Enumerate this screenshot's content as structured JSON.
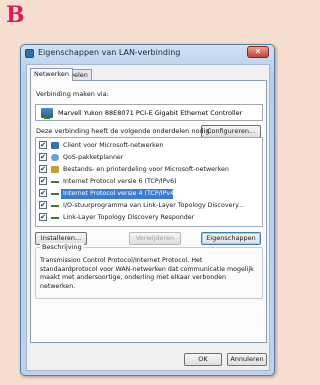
{
  "figure_letter": "B",
  "window": {
    "title": "Eigenschappen van LAN-verbinding",
    "close_symbol": "✕"
  },
  "tabs": [
    {
      "label": "Netwerken",
      "active": true
    },
    {
      "label": "Delen",
      "active": false
    }
  ],
  "connection": {
    "label": "Verbinding maken via:",
    "adapter": "Marvell Yukon 88E8071 PCI-E Gigabit Ethernet Controller",
    "configure_button": "Configureren..."
  },
  "items_label": "Deze verbinding heeft de volgende onderdelen nodig:",
  "items": [
    {
      "label": "Client voor Microsoft-netwerken",
      "checked": true,
      "icon": "client-icon",
      "selected": false
    },
    {
      "label": "QoS-pakketplanner",
      "checked": true,
      "icon": "qos-icon",
      "selected": false
    },
    {
      "label": "Bestands- en printerdeling voor Microsoft-netwerken",
      "checked": true,
      "icon": "share-icon",
      "selected": false
    },
    {
      "label": "Internet Protocol versie 6 (TCP/IPv6)",
      "checked": true,
      "icon": "protocol-icon",
      "selected": false
    },
    {
      "label": "Internet Protocol versie 4 (TCP/IPv4)",
      "checked": true,
      "icon": "protocol-icon",
      "selected": true
    },
    {
      "label": "I/O-stuurprogramma van Link-Layer Topology Discovery...",
      "checked": true,
      "icon": "protocol-icon",
      "selected": false
    },
    {
      "label": "Link-Layer Topology Discovery Responder",
      "checked": true,
      "icon": "protocol-icon",
      "selected": false
    }
  ],
  "buttons": {
    "install": "Installeren...",
    "remove": "Verwijderen",
    "properties": "Eigenschappen",
    "ok": "OK",
    "cancel": "Annuleren"
  },
  "description": {
    "title": "Beschrijving",
    "text": "Transmission Control Protocol/Internet Protocol. Het standaardprotocol voor WAN-netwerken dat communicatie mogelijk maakt met andersoortige, onderling met elkaar verbonden netwerken."
  },
  "colors": {
    "background": "#f6ded0",
    "letter": "#d81c5a",
    "selection": "#3a7bd5"
  }
}
